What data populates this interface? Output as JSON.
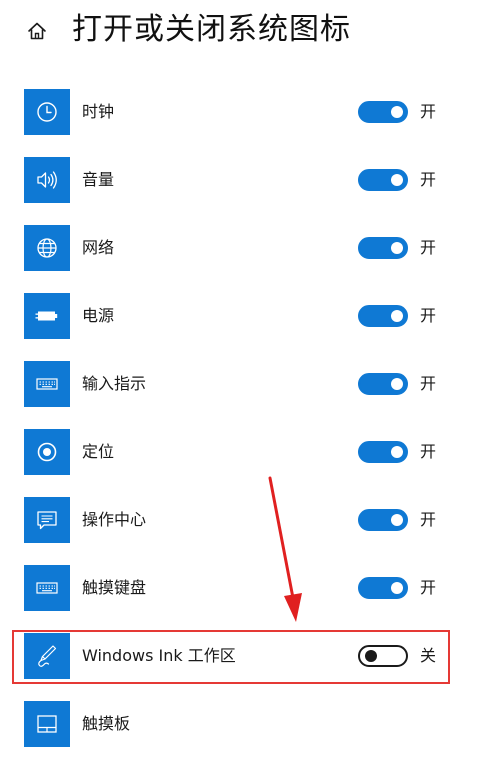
{
  "header": {
    "title": "打开或关闭系统图标",
    "home_icon": "home-icon"
  },
  "colors": {
    "accent": "#0f79d4",
    "highlight": "#e53935",
    "text": "#1a1a1a"
  },
  "items": [
    {
      "label": "时钟",
      "icon": "clock-icon",
      "on": true,
      "state": "开"
    },
    {
      "label": "音量",
      "icon": "volume-icon",
      "on": true,
      "state": "开"
    },
    {
      "label": "网络",
      "icon": "globe-icon",
      "on": true,
      "state": "开"
    },
    {
      "label": "电源",
      "icon": "battery-icon",
      "on": true,
      "state": "开"
    },
    {
      "label": "输入指示",
      "icon": "keyboard-icon",
      "on": true,
      "state": "开"
    },
    {
      "label": "定位",
      "icon": "location-icon",
      "on": true,
      "state": "开"
    },
    {
      "label": "操作中心",
      "icon": "action-center-icon",
      "on": true,
      "state": "开"
    },
    {
      "label": "触摸键盘",
      "icon": "touch-keyboard-icon",
      "on": true,
      "state": "开"
    },
    {
      "label": "Windows Ink 工作区",
      "icon": "pen-icon",
      "on": false,
      "state": "关"
    },
    {
      "label": "触摸板",
      "icon": "touchpad-icon",
      "on": null
    }
  ]
}
